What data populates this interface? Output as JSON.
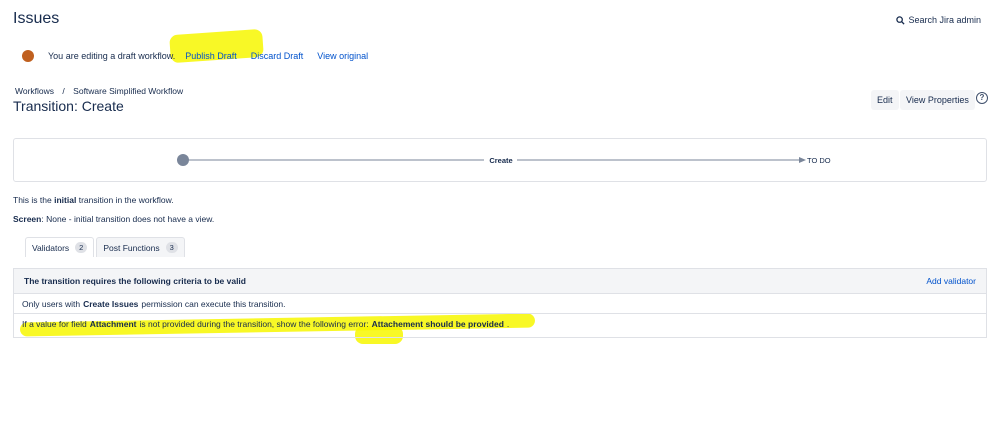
{
  "header": {
    "title": "Issues",
    "search_label": "Search Jira admin"
  },
  "draft_bar": {
    "message": "You are editing a draft workflow.",
    "publish": "Publish Draft",
    "discard": "Discard Draft",
    "view_original": "View original"
  },
  "breadcrumb": {
    "root": "Workflows",
    "separator": "/",
    "current": "Software Simplified Workflow"
  },
  "title": "Transition: Create",
  "buttons": {
    "edit": "Edit",
    "view_properties": "View Properties",
    "help": "?"
  },
  "diagram": {
    "transition": "Create",
    "target": "TO DO"
  },
  "info": {
    "initial_pre": "This is the",
    "initial_bold": "initial",
    "initial_post": "transition in the workflow.",
    "screen_label": "Screen",
    "screen_text": ": None - initial transition does not have a view."
  },
  "tabs": [
    {
      "label": "Validators",
      "count": "2"
    },
    {
      "label": "Post Functions",
      "count": "3"
    }
  ],
  "panel": {
    "header": "The transition requires the following criteria to be valid",
    "add": "Add validator",
    "row1": {
      "pre": "Only users with",
      "bold": "Create Issues",
      "post": "permission can execute this transition."
    },
    "row2": {
      "pre": "If a value for field",
      "field": "Attachment",
      "mid": "is not provided during the transition, show the following error:",
      "error": "Attachement should be provided",
      "end": "."
    }
  },
  "colors": {
    "highlight": "#f7f700",
    "link": "#0052cc",
    "draft_dot": "#c0601f"
  }
}
